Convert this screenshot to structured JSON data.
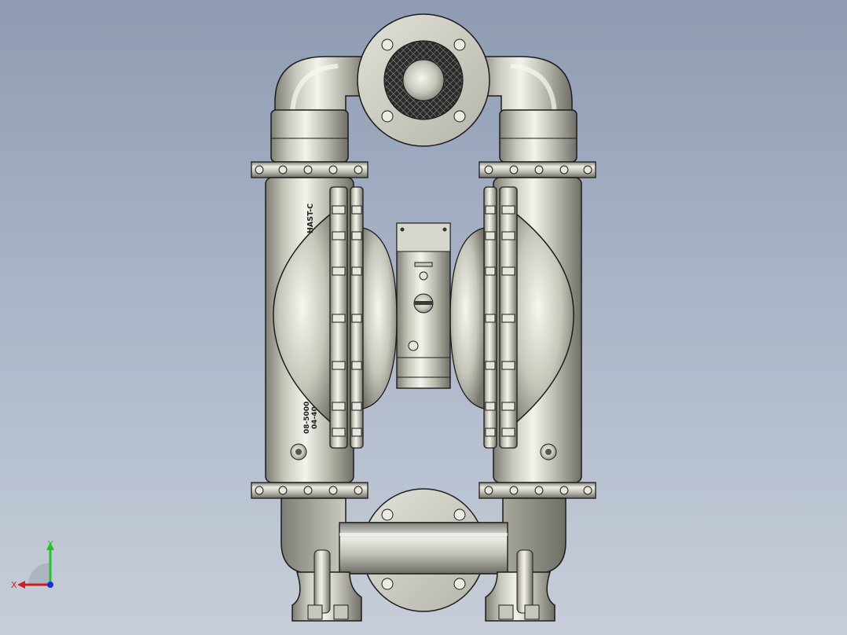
{
  "viewport": {
    "background_top": "#8e9bb2",
    "background_bottom": "#c7ced9"
  },
  "model": {
    "material_color": "#d2d1c6",
    "edge_color": "#1c1c1c",
    "engravings": {
      "material": "HAST-C",
      "part_number_line1": "08-5000",
      "part_number_line2": "04-40"
    }
  },
  "triad": {
    "x_label": "X",
    "y_label": "Y",
    "x_color": "#d11c1c",
    "y_color": "#27c227",
    "z_color": "#1c2fd6"
  }
}
